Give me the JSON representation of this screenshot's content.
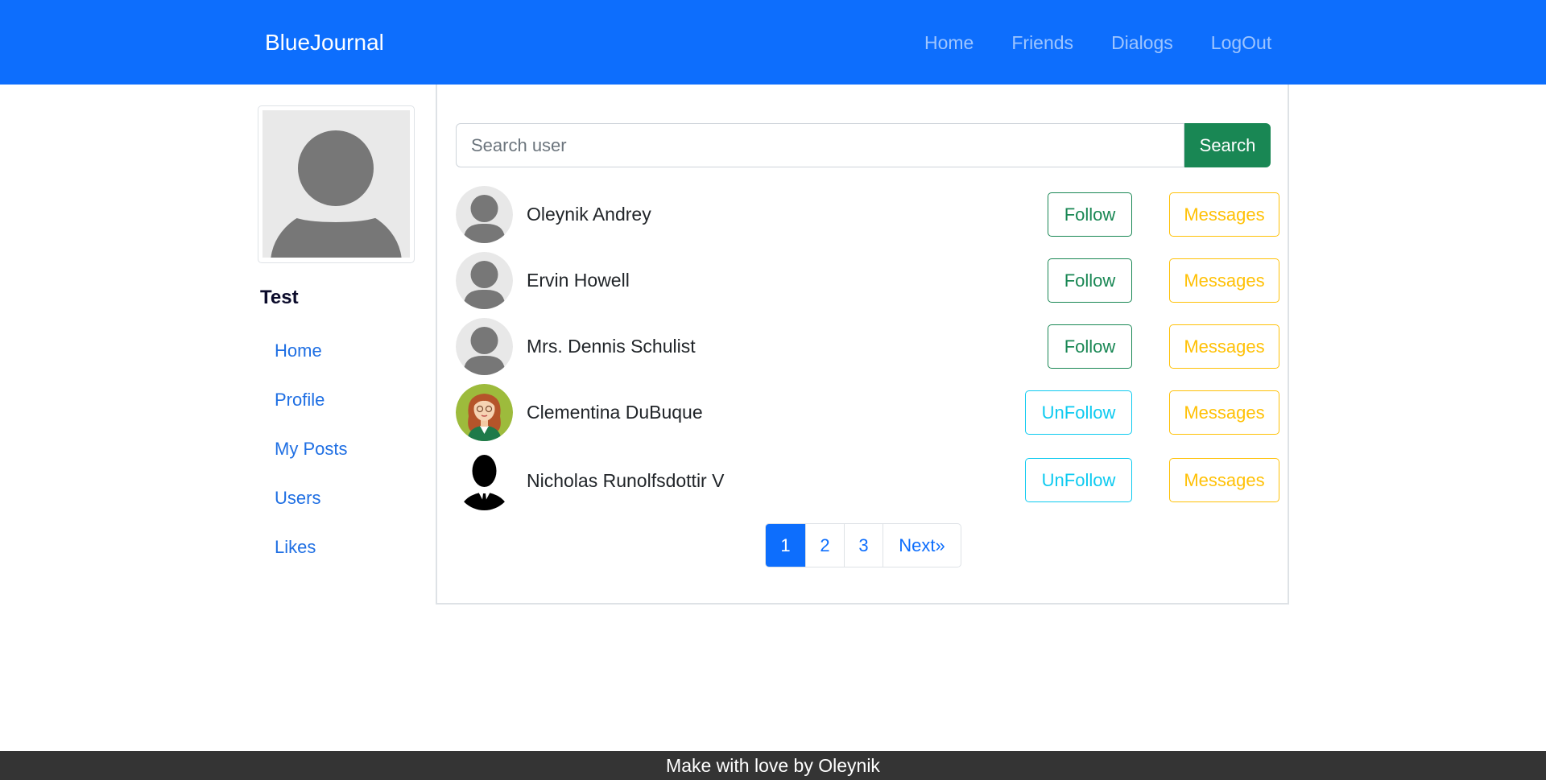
{
  "navbar": {
    "brand": "BlueJournal",
    "links": [
      "Home",
      "Friends",
      "Dialogs",
      "LogOut"
    ]
  },
  "sidebar": {
    "user_name": "Test",
    "links": [
      "Home",
      "Profile",
      "My Posts",
      "Users",
      "Likes"
    ]
  },
  "search": {
    "placeholder": "Search user",
    "button_label": "Search"
  },
  "users": [
    {
      "name": "Oleynik Andrey",
      "follow_label": "Follow",
      "message_label": "Messages",
      "avatar": "default-avatar-icon"
    },
    {
      "name": "Ervin Howell",
      "follow_label": "Follow",
      "message_label": "Messages",
      "avatar": "default-avatar-icon"
    },
    {
      "name": "Mrs. Dennis Schulist",
      "follow_label": "Follow",
      "message_label": "Messages",
      "avatar": "default-avatar-icon"
    },
    {
      "name": "Clementina DuBuque",
      "follow_label": "UnFollow",
      "message_label": "Messages",
      "avatar": "woman-avatar-icon"
    },
    {
      "name": "Nicholas Runolfsdottir V",
      "follow_label": "UnFollow",
      "message_label": "Messages",
      "avatar": "man-silhouette-avatar-icon"
    }
  ],
  "pagination": {
    "pages": [
      "1",
      "2",
      "3"
    ],
    "active": "1",
    "next_label": "Next»"
  },
  "footer": {
    "text": "Make with love by Oleynik"
  },
  "colors": {
    "navbar": "#0d6efd",
    "follow": "#198754",
    "unfollow": "#0dcaf0",
    "messages": "#ffc107",
    "footer": "#343434"
  }
}
